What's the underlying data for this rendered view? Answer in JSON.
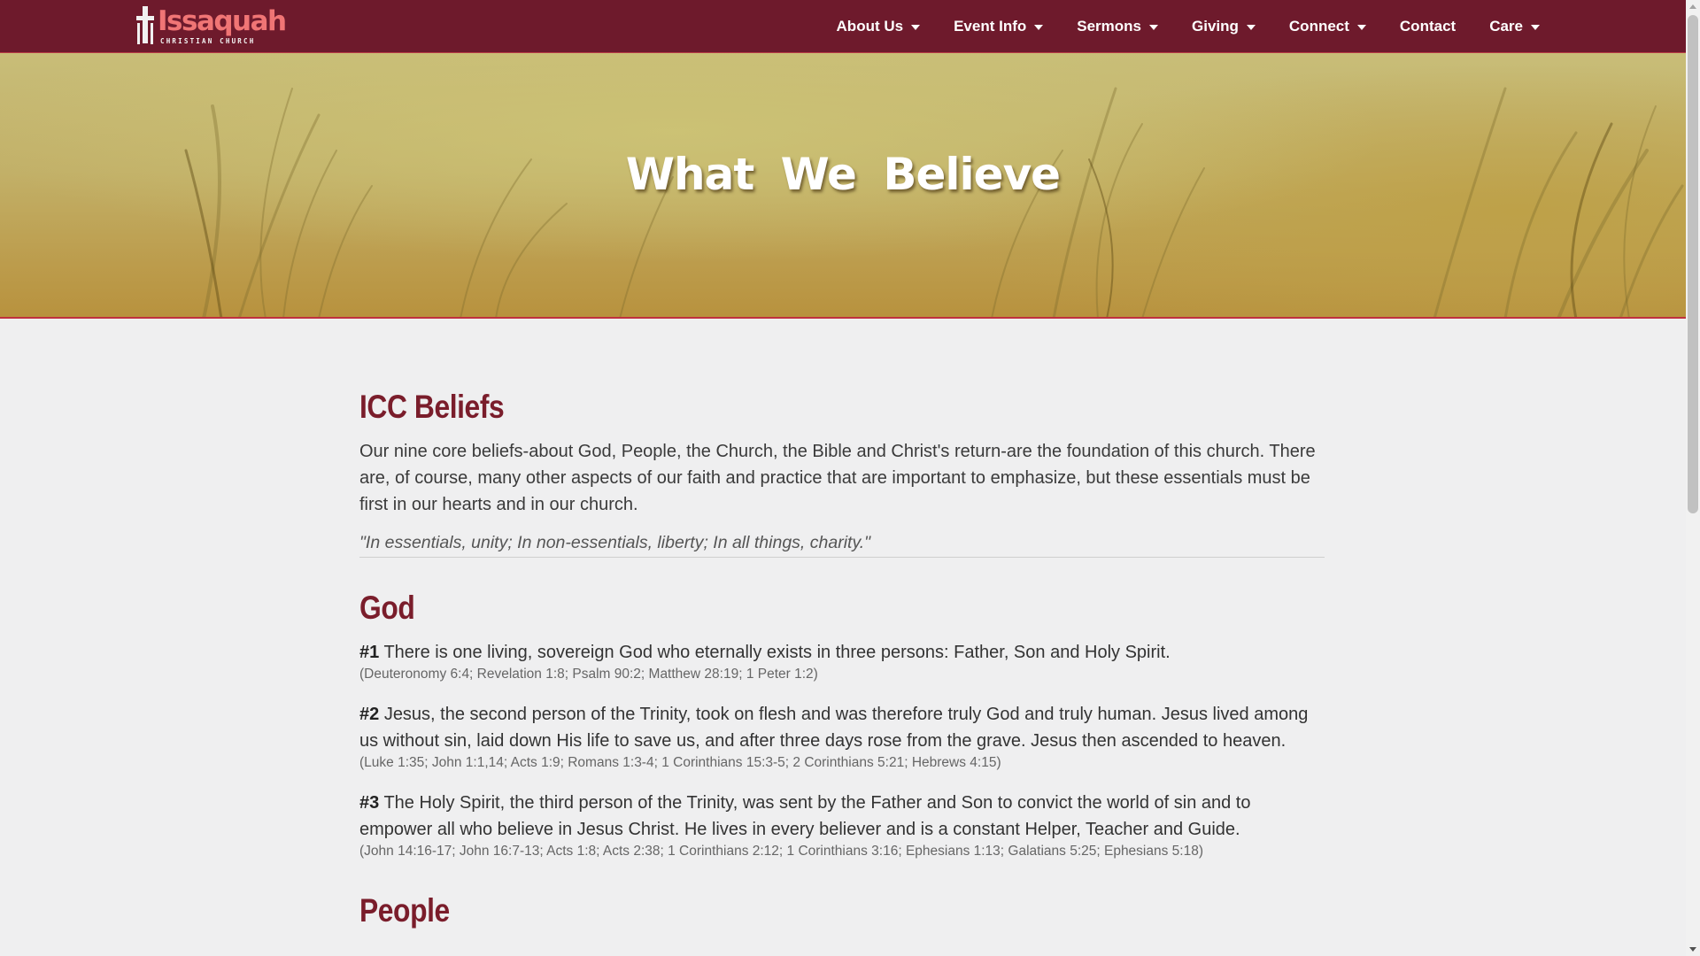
{
  "brand": {
    "name": "Issaquah",
    "subtitle": "CHRISTIAN CHURCH",
    "logo_icon": "cross-logo-icon"
  },
  "nav": {
    "items": [
      {
        "label": "About Us",
        "dropdown": true
      },
      {
        "label": "Event Info",
        "dropdown": true
      },
      {
        "label": "Sermons",
        "dropdown": true
      },
      {
        "label": "Giving",
        "dropdown": true
      },
      {
        "label": "Connect",
        "dropdown": true
      },
      {
        "label": "Contact",
        "dropdown": false
      },
      {
        "label": "Care",
        "dropdown": true
      }
    ]
  },
  "hero": {
    "title": "What We Believe"
  },
  "beliefs_section": {
    "title": "ICC Beliefs",
    "intro": "Our nine core beliefs-about God, People, the Church, the Bible and Christ's return-are the foundation of this church. There are, of course, many other aspects of our faith and practice that are important to emphasize, but these essentials must be first in our hearts and in our church.",
    "quote": "\"In essentials, unity; In non-essentials, liberty; In all things, charity.\""
  },
  "god_section": {
    "title": "God",
    "beliefs": [
      {
        "number": "#1",
        "text": "There is one living, sovereign God who eternally exists in three persons: Father, Son and Holy Spirit.",
        "refs": "(Deuteronomy 6:4; Revelation 1:8; Psalm 90:2; Matthew 28:19; 1 Peter 1:2)"
      },
      {
        "number": "#2",
        "text": "Jesus, the second person of the Trinity, took on flesh and was therefore truly God and truly human. Jesus lived among us without sin, laid down His life to save us, and after three days rose from the grave. Jesus then ascended to heaven.",
        "refs": "(Luke 1:35; John 1:1,14; Acts 1:9; Romans 1:3-4; 1 Corinthians 15:3-5; 2 Corinthians 5:21; Hebrews 4:15)"
      },
      {
        "number": "#3",
        "text": "The Holy Spirit, the third person of the Trinity, was sent by the Father and Son to convict the world of sin and to empower all who believe in Jesus Christ. He lives in every believer and is a constant Helper, Teacher and Guide.",
        "refs": "(John 14:16-17; John 16:7-13; Acts 1:8; Acts 2:38; 1 Corinthians 2:12; 1 Corinthians 3:16; Ephesians 1:13; Galatians 5:25; Ephesians 5:18)"
      }
    ]
  },
  "people_section": {
    "title": "People"
  },
  "colors": {
    "nav_bg": "#6e1a2c",
    "heading": "#7a1d2b",
    "logo_accent": "#f07575",
    "page_bg": "#efeff0"
  }
}
